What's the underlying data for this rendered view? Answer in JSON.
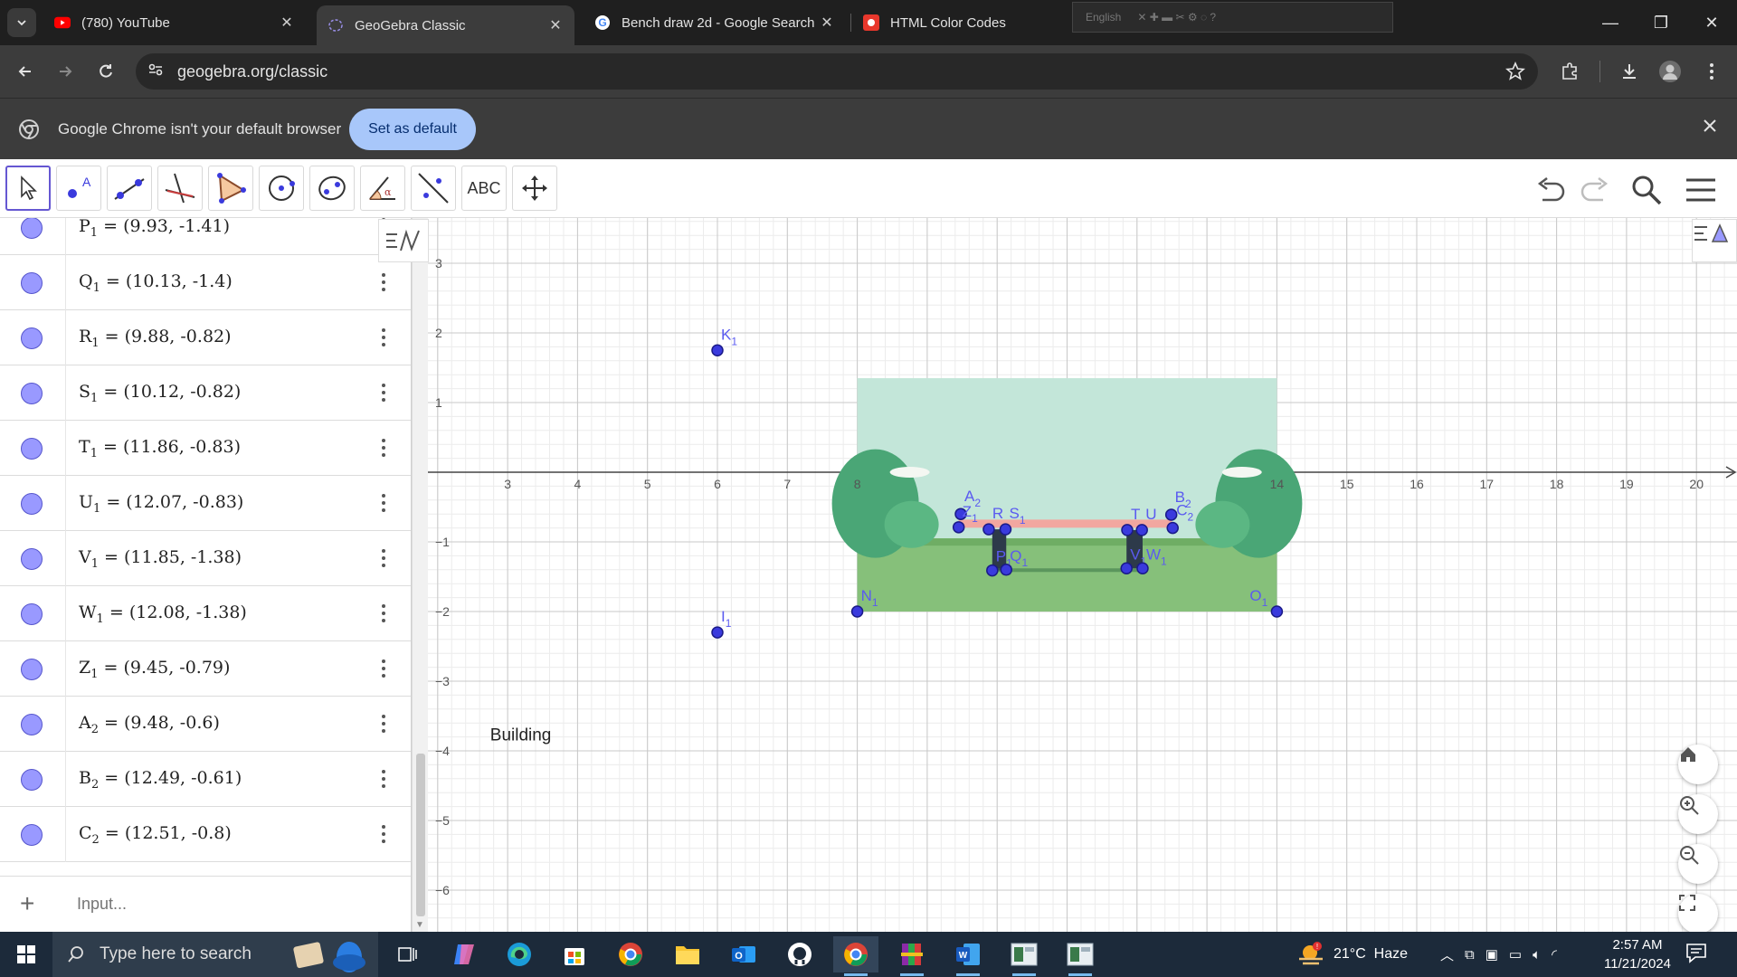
{
  "browser": {
    "tabs": [
      {
        "title": "(780) YouTube",
        "favicon": "youtube-icon",
        "active": false
      },
      {
        "title": "GeoGebra Classic",
        "favicon": "geogebra-icon",
        "active": true
      },
      {
        "title": "Bench draw 2d - Google Search",
        "favicon": "google-icon",
        "active": false
      },
      {
        "title": "HTML Color Codes",
        "favicon": "htmlcolorcodes-icon",
        "active": false
      }
    ],
    "ime_label": "English",
    "url": "geogebra.org/classic",
    "infobar": {
      "message": "Google Chrome isn't your default browser",
      "button": "Set as default"
    }
  },
  "geogebra": {
    "toolbar": {
      "tools": [
        "move-tool",
        "point-tool",
        "line-tool",
        "perpendicular-line-tool",
        "polygon-tool",
        "circle-tool",
        "ellipse-tool",
        "angle-tool",
        "reflect-tool",
        "text-tool",
        "move-graphics-tool"
      ],
      "text_tool_label": "ABC"
    },
    "algebra": {
      "rows": [
        {
          "name": "P",
          "sub": "1",
          "value": "(9.93, -1.41)"
        },
        {
          "name": "Q",
          "sub": "1",
          "value": "(10.13, -1.4)"
        },
        {
          "name": "R",
          "sub": "1",
          "value": "(9.88, -0.82)"
        },
        {
          "name": "S",
          "sub": "1",
          "value": "(10.12, -0.82)"
        },
        {
          "name": "T",
          "sub": "1",
          "value": "(11.86, -0.83)"
        },
        {
          "name": "U",
          "sub": "1",
          "value": "(12.07, -0.83)"
        },
        {
          "name": "V",
          "sub": "1",
          "value": "(11.85, -1.38)"
        },
        {
          "name": "W",
          "sub": "1",
          "value": "(12.08, -1.38)"
        },
        {
          "name": "Z",
          "sub": "1",
          "value": "(9.45, -0.79)"
        },
        {
          "name": "A",
          "sub": "2",
          "value": "(9.48, -0.6)"
        },
        {
          "name": "B",
          "sub": "2",
          "value": "(12.49, -0.61)"
        },
        {
          "name": "C",
          "sub": "2",
          "value": "(12.51, -0.8)"
        }
      ],
      "input_placeholder": "Input..."
    },
    "graphics": {
      "x_ticks": [
        "3",
        "4",
        "5",
        "6",
        "7",
        "8",
        "14",
        "15",
        "16",
        "17",
        "18",
        "19",
        "20"
      ],
      "y_ticks": [
        "3",
        "2",
        "1",
        "−1",
        "−2",
        "−3",
        "−4",
        "−5",
        "−6"
      ],
      "text_object": "Building",
      "point_labels": {
        "K": "K",
        "K_sub": "1",
        "I": "I",
        "I_sub": "1",
        "N": "N",
        "N_sub": "1",
        "O": "O",
        "O_sub": "1",
        "A2": "A",
        "A2_sub": "2",
        "Z1": "Z",
        "Z1_sub": "1",
        "R": "R",
        "S": "S",
        "S_sub": "1",
        "T": "T",
        "U": "U",
        "B2": "B",
        "B2_sub": "2",
        "C2": "C",
        "C2_sub": "2",
        "P": "P",
        "P_sub": "1",
        "Q": "Q",
        "Q_sub": "1",
        "V": "V",
        "V_sub": "1",
        "W": "W",
        "W_sub": "1"
      },
      "point_color": "#3a3add",
      "label_color": "#5a5af0"
    }
  },
  "taskbar": {
    "search_placeholder": "Type here to search",
    "weather": "21°C  Haze",
    "time": "2:57 AM",
    "date": "11/21/2024"
  }
}
